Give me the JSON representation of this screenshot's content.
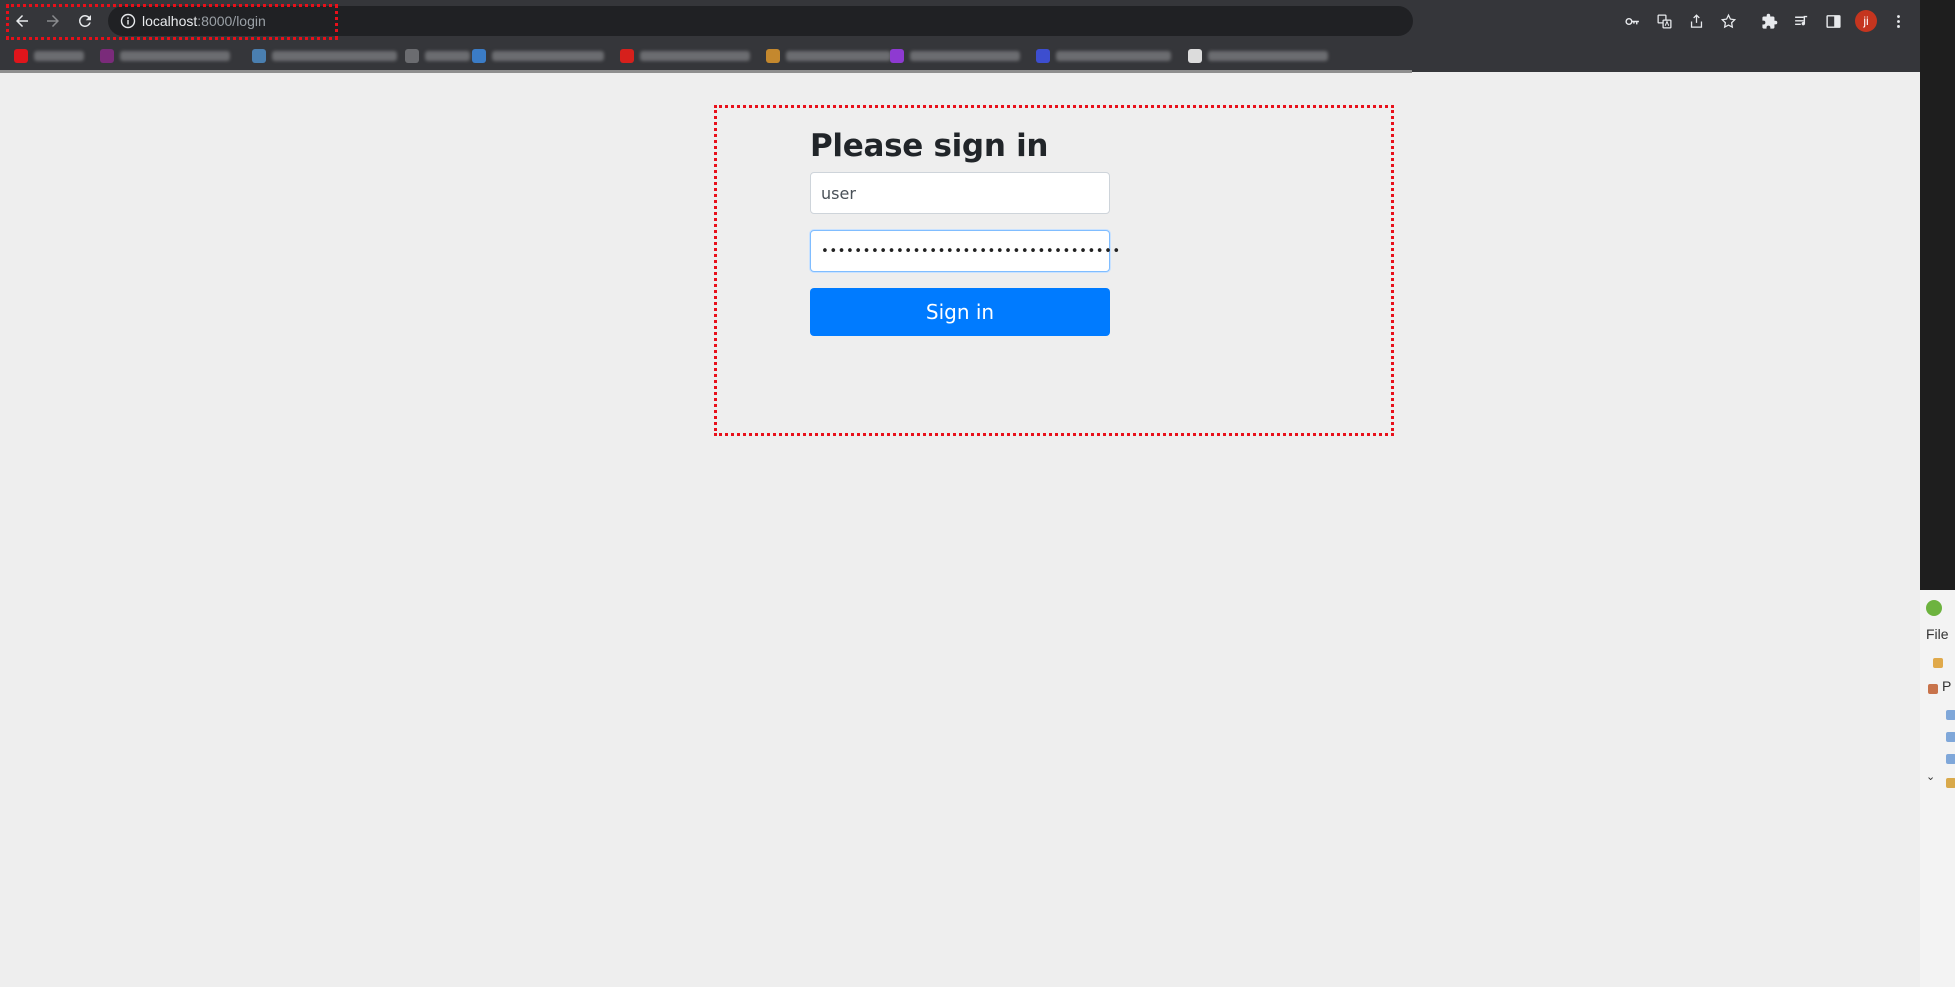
{
  "browser": {
    "url_host": "localhost",
    "url_rest": ":8000/login",
    "avatar_initial": "ji",
    "icons": [
      "back-arrow-icon",
      "forward-arrow-icon",
      "reload-icon",
      "info-icon",
      "key-icon",
      "translate-icon",
      "share-icon",
      "star-icon",
      "extensions-icon",
      "media-queue-icon",
      "side-panel-icon",
      "kebab-menu-icon"
    ],
    "bookmark_favicon_colors": [
      "#e0151b",
      "#7a2b7a",
      "#4a7fb0",
      "#3b7cc6",
      "#d6201c",
      "#c4882e",
      "#8e3ad1",
      "#3d4ecf",
      "#dcdcdc"
    ]
  },
  "login": {
    "heading": "Please sign in",
    "username_value": "user",
    "password_mask": "••••••••••••••••••••••••••••••••••••",
    "button_label": "Sign in",
    "colors": {
      "primary": "#007bff",
      "highlight": "#e8101a"
    }
  },
  "ide": {
    "menu_file": "File",
    "tree_label": "P"
  }
}
